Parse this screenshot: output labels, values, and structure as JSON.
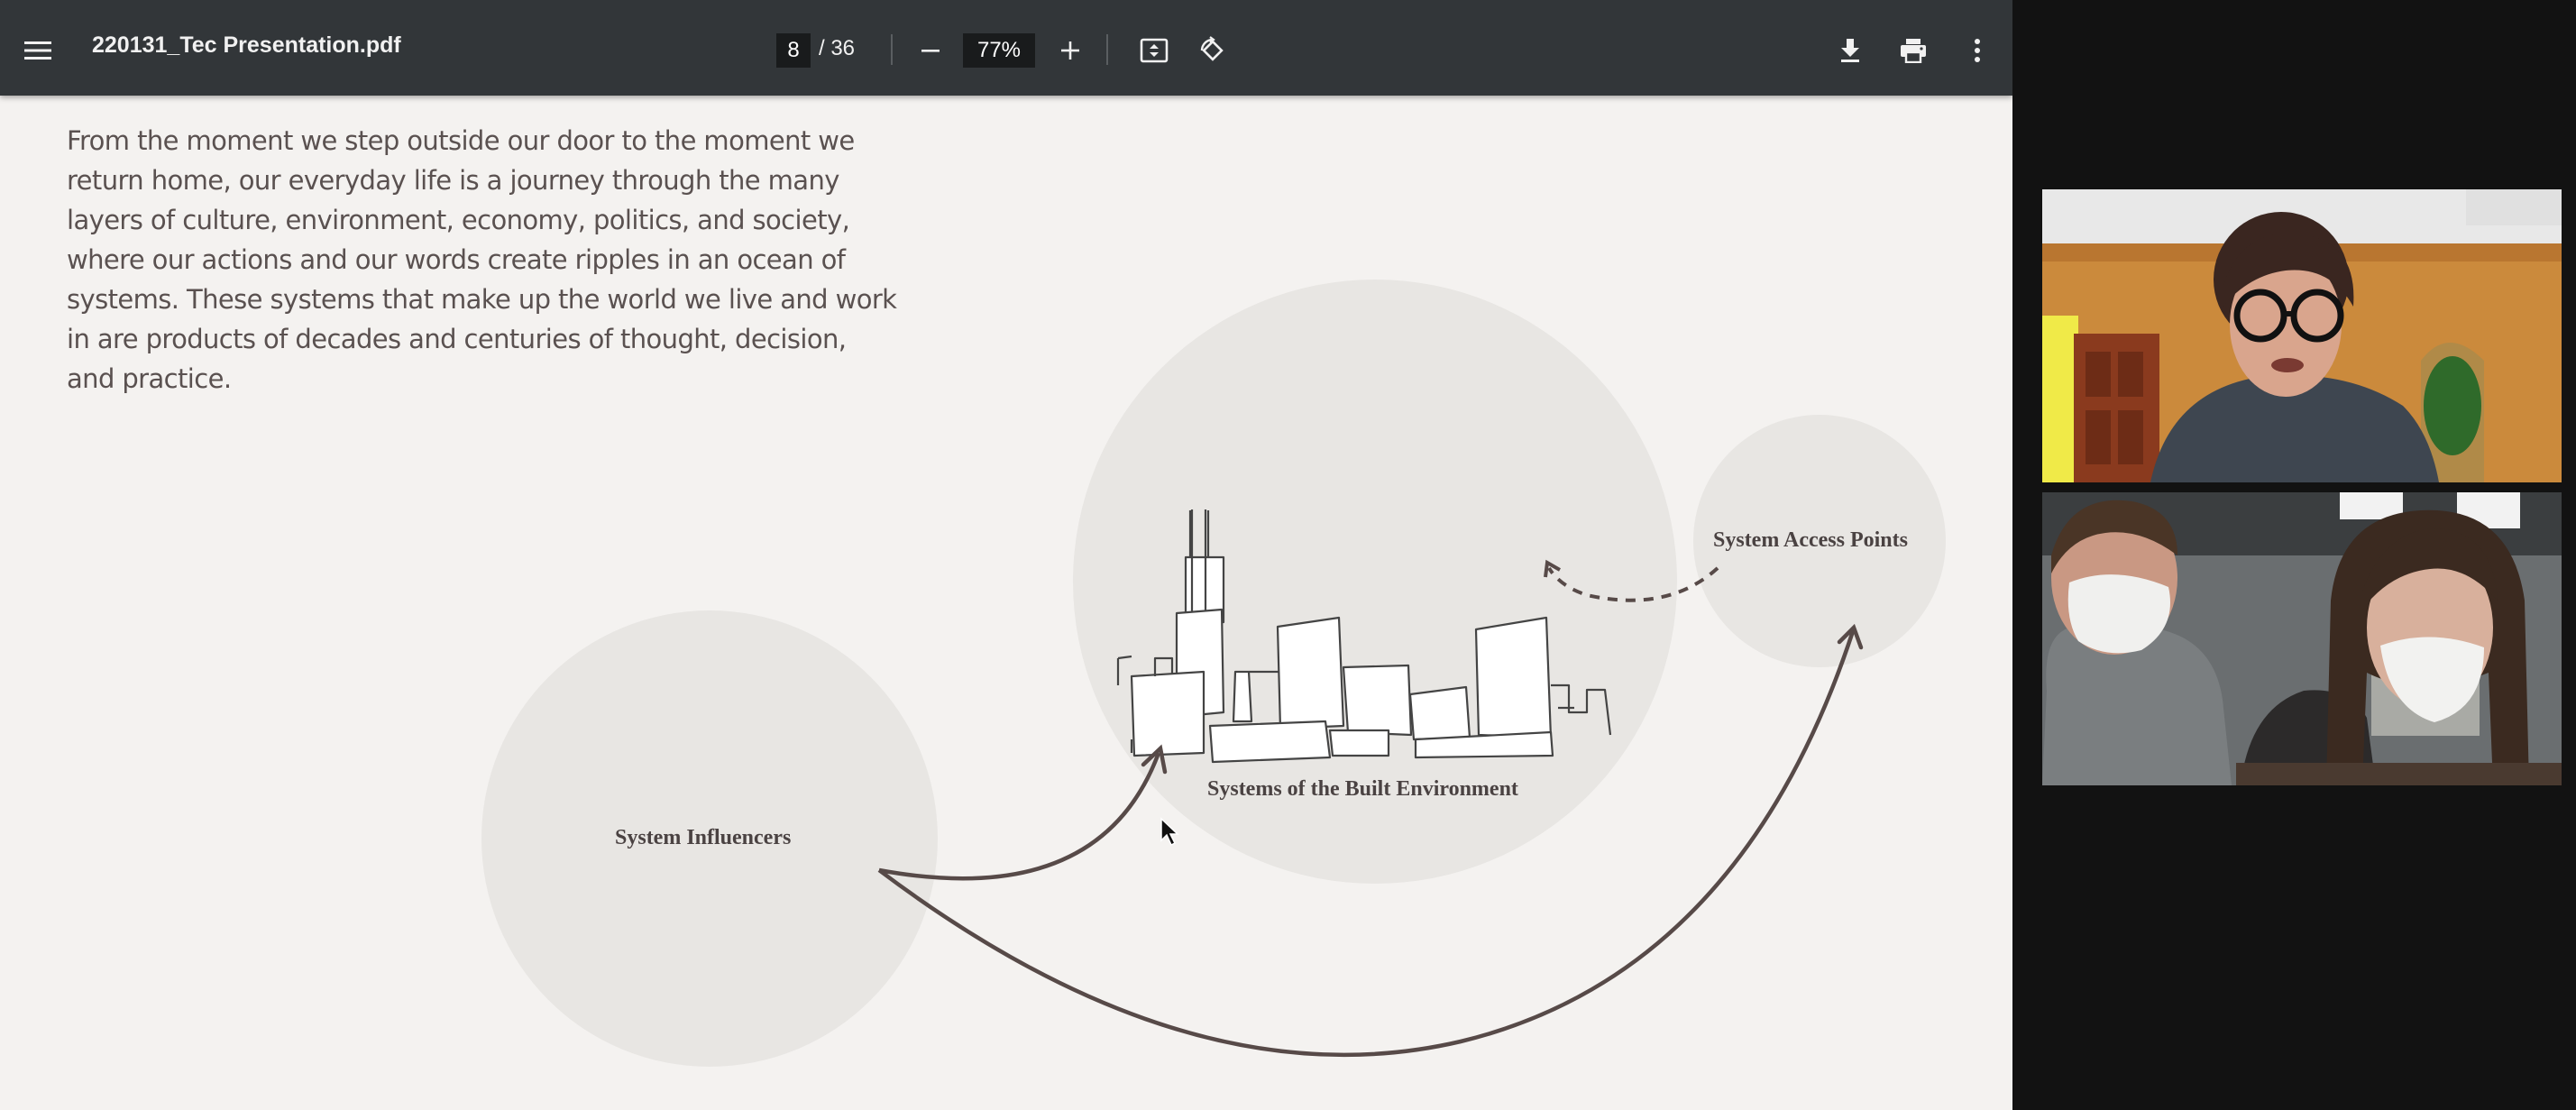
{
  "toolbar": {
    "filename": "220131_Tec Presentation.pdf",
    "current_page": "8",
    "page_total": "/ 36",
    "zoom": "77%"
  },
  "content": {
    "paragraph_lines": [
      "From the moment we step outside our door to the moment we",
      "return home, our everyday life is a journey through the many",
      "layers of culture, environment, economy, politics, and society,",
      "where our actions and our words create ripples in an ocean of",
      "systems. These systems that make up the world we live and work",
      "in are products of decades and centuries of thought, decision,",
      "and practice."
    ]
  },
  "diagram": {
    "influencers_label": "System Influencers",
    "built_env_label": "Systems of the Built Environment",
    "access_label": "System Access Points"
  },
  "colors": {
    "toolbar_bg": "#323639",
    "page_bg": "#f4f2f0",
    "circle_fill": "#e8e6e3",
    "arrow": "#574a48",
    "meeting_bg": "#121212"
  }
}
